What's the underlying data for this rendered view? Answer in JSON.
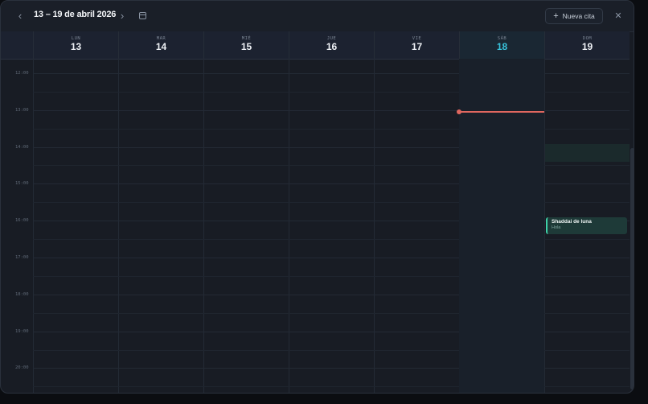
{
  "header": {
    "range_title": "13 – 19 de abril 2026",
    "prev_icon": "chevron-left-icon",
    "next_icon": "chevron-right-icon",
    "calendar_icon": "calendar-icon",
    "new_button_label": "Nueva cita",
    "close_icon": "close-icon"
  },
  "days": [
    {
      "name": "LUN",
      "num": "13"
    },
    {
      "name": "MAR",
      "num": "14"
    },
    {
      "name": "MIÉ",
      "num": "15"
    },
    {
      "name": "JUE",
      "num": "16"
    },
    {
      "name": "VIE",
      "num": "17"
    },
    {
      "name": "SÁB",
      "num": "18",
      "today": true
    },
    {
      "name": "DOM",
      "num": "19"
    }
  ],
  "hours": [
    "12:00",
    "13:00",
    "14:00",
    "15:00",
    "16:00",
    "17:00",
    "18:00",
    "19:00",
    "20:00"
  ],
  "event": {
    "title": "Shaddai de luna",
    "subtitle": "Hola",
    "day": "19",
    "accent_color": "#3ed1a8"
  },
  "colors": {
    "today_accent": "#38c3dc",
    "now_indicator": "#e0675f"
  }
}
